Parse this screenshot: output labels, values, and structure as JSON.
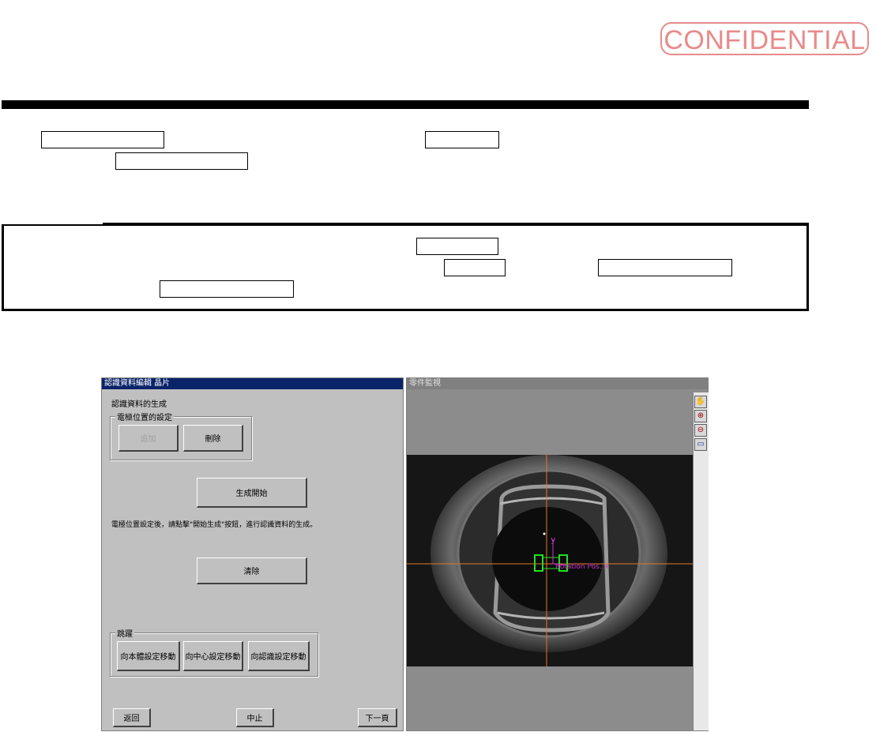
{
  "stamp": {
    "text": "CONFIDENTIAL"
  },
  "app_window": {
    "title": "認識資料編輯 晶片",
    "section_label": "認識資料的生成",
    "electrode_group": {
      "title": "電極位置的設定",
      "add_button": "追加",
      "delete_button": "刪除"
    },
    "generate_button": "生成開始",
    "instruction_text": "電極位置設定後，請點擊\"開始生成\"按鈕，進行認識資料的生成。",
    "clear_button": "清除",
    "jump_group": {
      "title": "跳躍",
      "buttons": [
        "向本體設定移動",
        "向中心設定移動",
        "向認識設定移動"
      ]
    },
    "back_button": "返回",
    "stop_button": "中止",
    "next_button": "下一頁"
  },
  "viewer_window": {
    "title": "零件監視",
    "axis_label_y": "y",
    "overlay_text": "Rotation Pos. +"
  },
  "tools": [
    "hand-icon",
    "zoom-in-icon",
    "zoom-out-icon",
    "fit-window-icon"
  ],
  "colors": {
    "stamp": "#e88a8a",
    "title_active": "#0a246a",
    "crosshair": "#e0782a",
    "marker": "#22e022",
    "overlay_text": "#cc33cc"
  }
}
